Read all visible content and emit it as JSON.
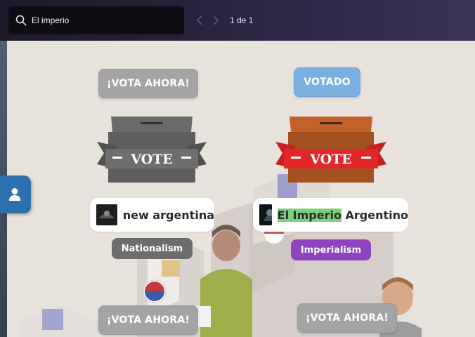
{
  "search": {
    "value": "El imperio",
    "counter": "1 de 1"
  },
  "cards": [
    {
      "button": "¡VOTA AHORA!",
      "box_label": "VOTE",
      "name": "new argentina",
      "tag": "Nationalism",
      "tag_color": "#6d6d6d",
      "state": "not-voted"
    },
    {
      "button": "VOTADO",
      "box_label": "VOTE",
      "name_highlight": "El Imperio",
      "name_rest": " Argentino",
      "tag": "Imperialism",
      "tag_color": "#8e44c0",
      "state": "voted"
    }
  ],
  "lower_buttons": [
    "¡VOTA AHORA!",
    "¡VOTA AHORA!"
  ],
  "colors": {
    "gray_button": "#a4a4a4",
    "voted_button": "#79b0e0",
    "voted_box": "#c0622a",
    "ribbon_red": "#e0272a"
  }
}
